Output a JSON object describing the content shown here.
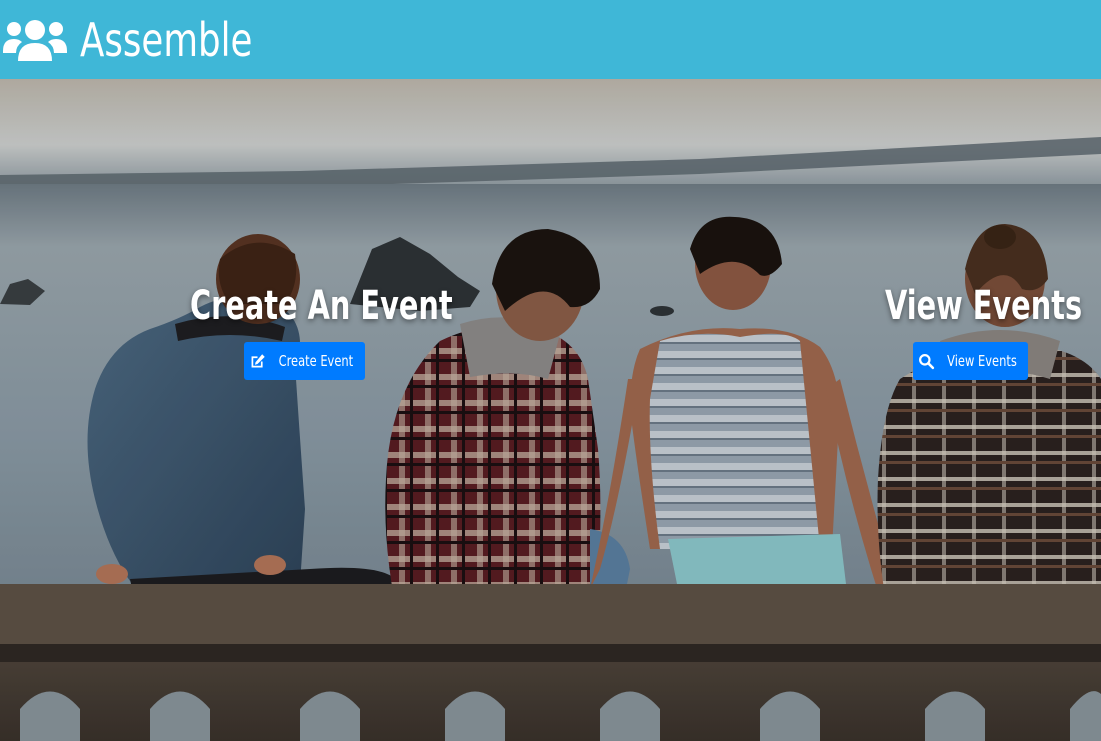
{
  "navbar": {
    "brand_title": "Assemble",
    "brand_icon": "users-icon",
    "background_color": "#3fb7d7"
  },
  "hero": {
    "photo_description_icon": "photo",
    "create": {
      "title": "Create An Event",
      "button_label": "Create Event",
      "button_icon": "edit-icon"
    },
    "view": {
      "title": "View Events",
      "button_label": "View Events",
      "button_icon": "search-icon"
    },
    "button_color": "#007bff"
  }
}
